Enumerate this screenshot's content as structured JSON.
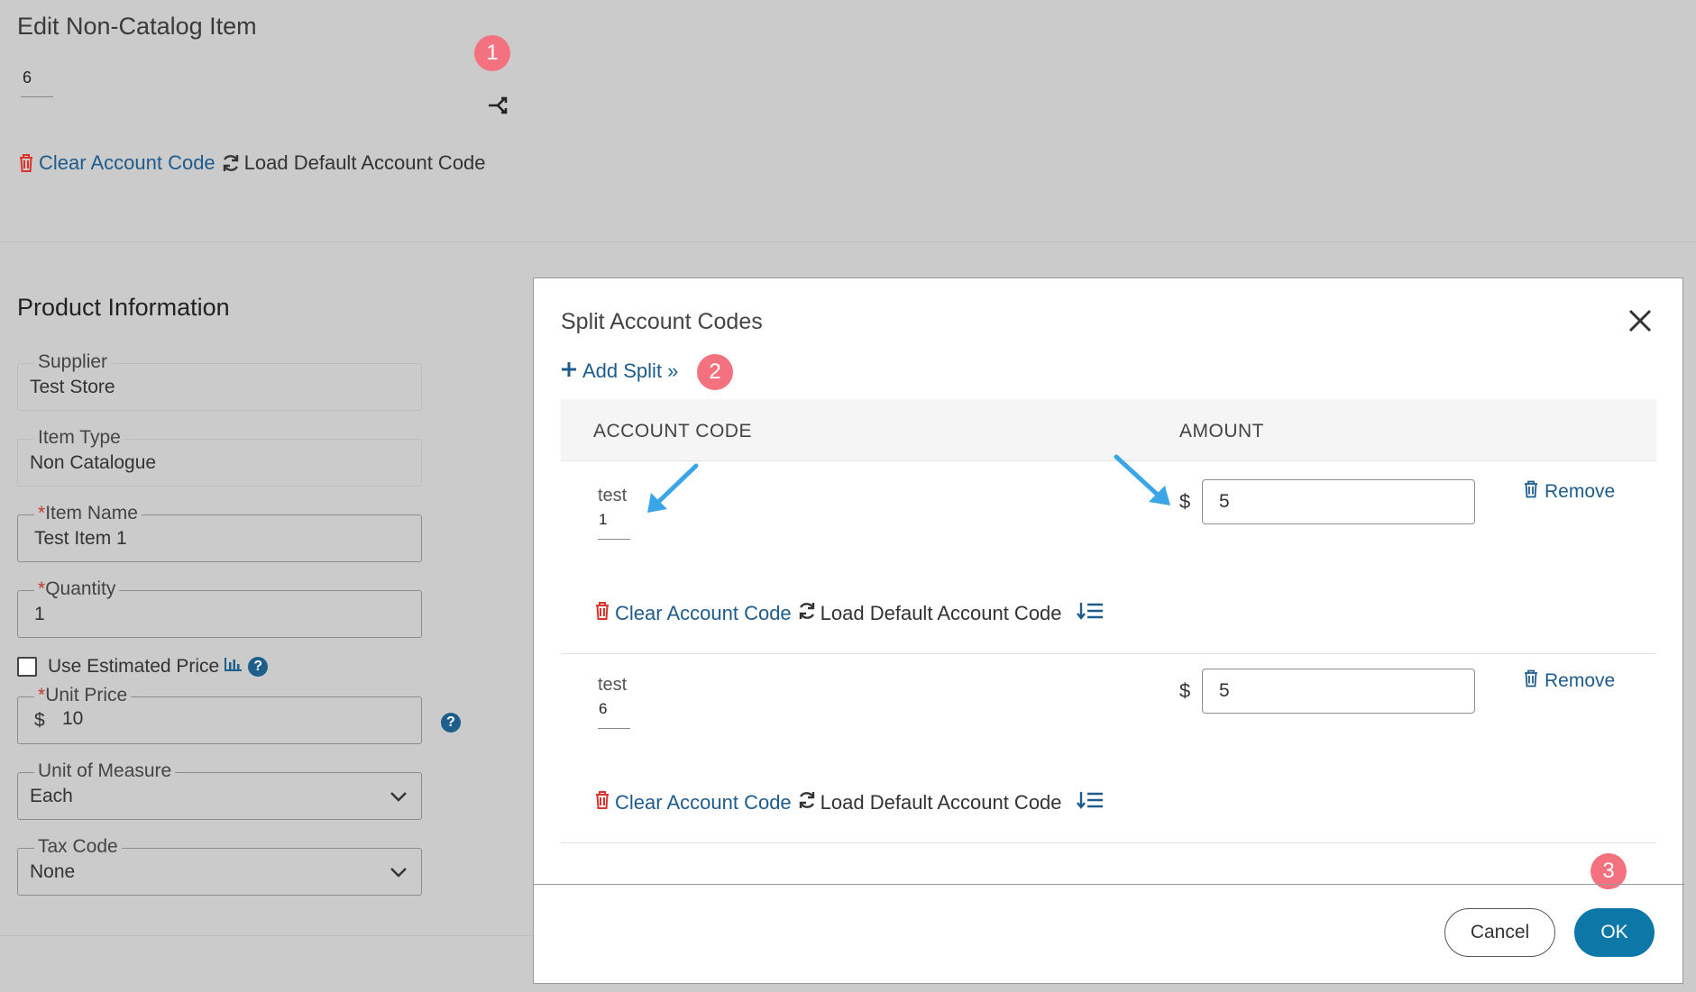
{
  "page": {
    "title": "Edit Non-Catalog Item",
    "account_code_value": "6",
    "clear_account_code": "Clear Account Code",
    "load_default_account_code": "Load Default Account Code"
  },
  "badges": [
    "1",
    "2",
    "3"
  ],
  "product": {
    "section_title": "Product Information",
    "supplier": {
      "label": "Supplier",
      "value": "Test Store"
    },
    "item_type": {
      "label": "Item Type",
      "value": "Non Catalogue"
    },
    "item_name": {
      "required": "*",
      "label": "Item Name",
      "value": "Test Item 1"
    },
    "quantity": {
      "required": "*",
      "label": "Quantity",
      "value": "1"
    },
    "use_estimated_price": {
      "label": "Use Estimated Price",
      "checked": false
    },
    "unit_price": {
      "required": "*",
      "label": "Unit Price",
      "currency": "$",
      "value": "10"
    },
    "unit_of_measure": {
      "label": "Unit of Measure",
      "value": "Each"
    },
    "tax_code": {
      "label": "Tax Code",
      "value": "None"
    }
  },
  "modal": {
    "title": "Split Account Codes",
    "add_split": "Add Split »",
    "columns": {
      "account_code": "ACCOUNT CODE",
      "amount": "AMOUNT"
    },
    "splits": [
      {
        "account_name": "test",
        "account_code": "1",
        "currency": "$",
        "amount": "5",
        "remove": "Remove",
        "clear": "Clear Account Code",
        "load_default": "Load Default Account Code"
      },
      {
        "account_name": "test",
        "account_code": "6",
        "currency": "$",
        "amount": "5",
        "remove": "Remove",
        "clear": "Clear Account Code",
        "load_default": "Load Default Account Code"
      }
    ],
    "cancel": "Cancel",
    "ok": "OK"
  },
  "colors": {
    "badge": "#f4727f",
    "link": "#1e5b8d",
    "ok_button": "#0d77a8",
    "trash": "#d9332b",
    "arrow": "#3aa6e8"
  }
}
